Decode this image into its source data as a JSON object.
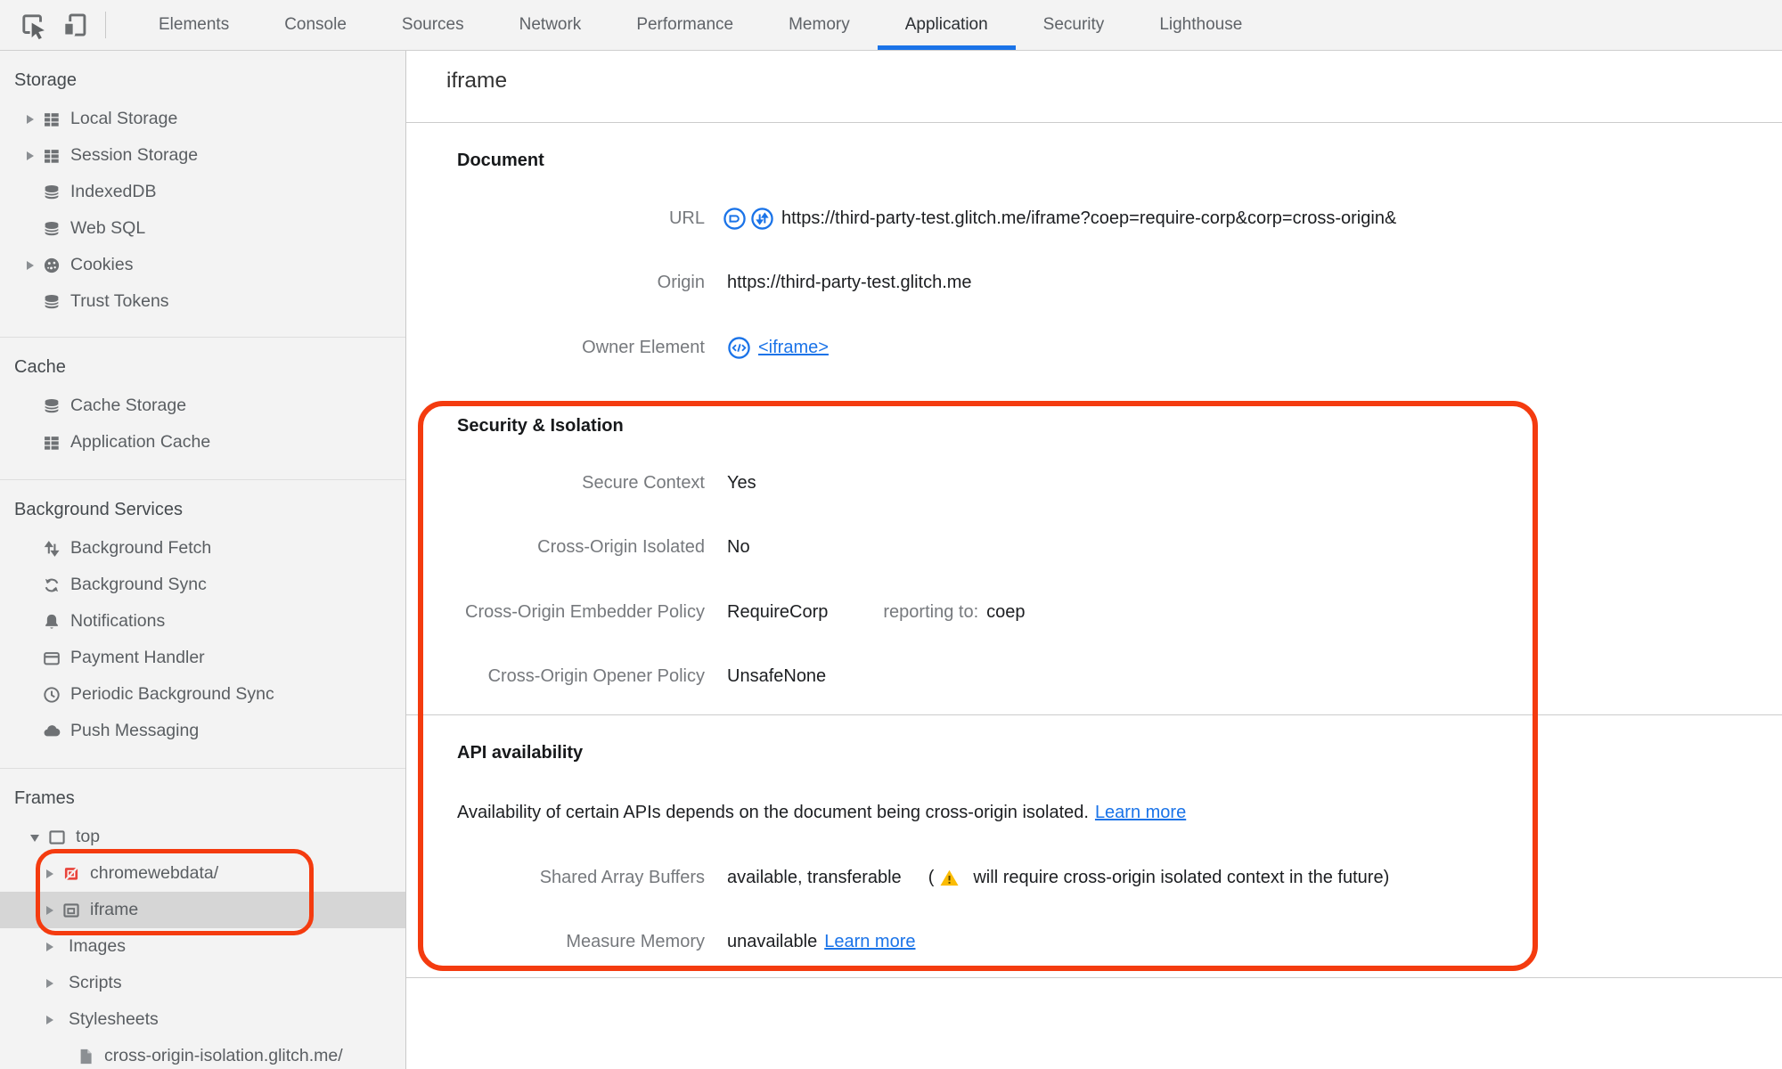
{
  "toolbar": {
    "tabs": [
      "Elements",
      "Console",
      "Sources",
      "Network",
      "Performance",
      "Memory",
      "Application",
      "Security",
      "Lighthouse"
    ],
    "selected_tab": "Application"
  },
  "sidebar": {
    "storage": {
      "title": "Storage",
      "items": [
        "Local Storage",
        "Session Storage",
        "IndexedDB",
        "Web SQL",
        "Cookies",
        "Trust Tokens"
      ]
    },
    "cache": {
      "title": "Cache",
      "items": [
        "Cache Storage",
        "Application Cache"
      ]
    },
    "background": {
      "title": "Background Services",
      "items": [
        "Background Fetch",
        "Background Sync",
        "Notifications",
        "Payment Handler",
        "Periodic Background Sync",
        "Push Messaging"
      ]
    },
    "frames": {
      "title": "Frames",
      "items": [
        "top",
        "chromewebdata/",
        "iframe",
        "Images",
        "Scripts",
        "Stylesheets",
        "cross-origin-isolation.glitch.me/"
      ],
      "selected_item": "iframe"
    }
  },
  "main": {
    "title": "iframe",
    "document": {
      "heading": "Document",
      "url_label": "URL",
      "url_value": "https://third-party-test.glitch.me/iframe?coep=require-corp&corp=cross-origin&",
      "origin_label": "Origin",
      "origin_value": "https://third-party-test.glitch.me",
      "owner_label": "Owner Element",
      "owner_link": "<iframe>"
    },
    "security": {
      "heading": "Security & Isolation",
      "secure_context_label": "Secure Context",
      "secure_context_value": "Yes",
      "coi_label": "Cross-Origin Isolated",
      "coi_value": "No",
      "coep_label": "Cross-Origin Embedder Policy",
      "coep_value": "RequireCorp",
      "coep_reporting_label": "reporting to:",
      "coep_reporting_value": "coep",
      "coop_label": "Cross-Origin Opener Policy",
      "coop_value": "UnsafeNone"
    },
    "api": {
      "heading": "API availability",
      "description": "Availability of certain APIs depends on the document being cross-origin isolated.",
      "description_link": "Learn more",
      "sab_label": "Shared Array Buffers",
      "sab_value": "available, transferable",
      "sab_paren": "(",
      "sab_warning": "will require cross-origin isolated context in the future)",
      "mm_label": "Measure Memory",
      "mm_value": "unavailable",
      "mm_link": "Learn more"
    }
  },
  "colors": {
    "accent_blue": "#1a73e8",
    "annotation_red": "#f43b0f",
    "warning_yellow": "#fbbc04",
    "selected_row_gray": "#d6d6d6"
  }
}
